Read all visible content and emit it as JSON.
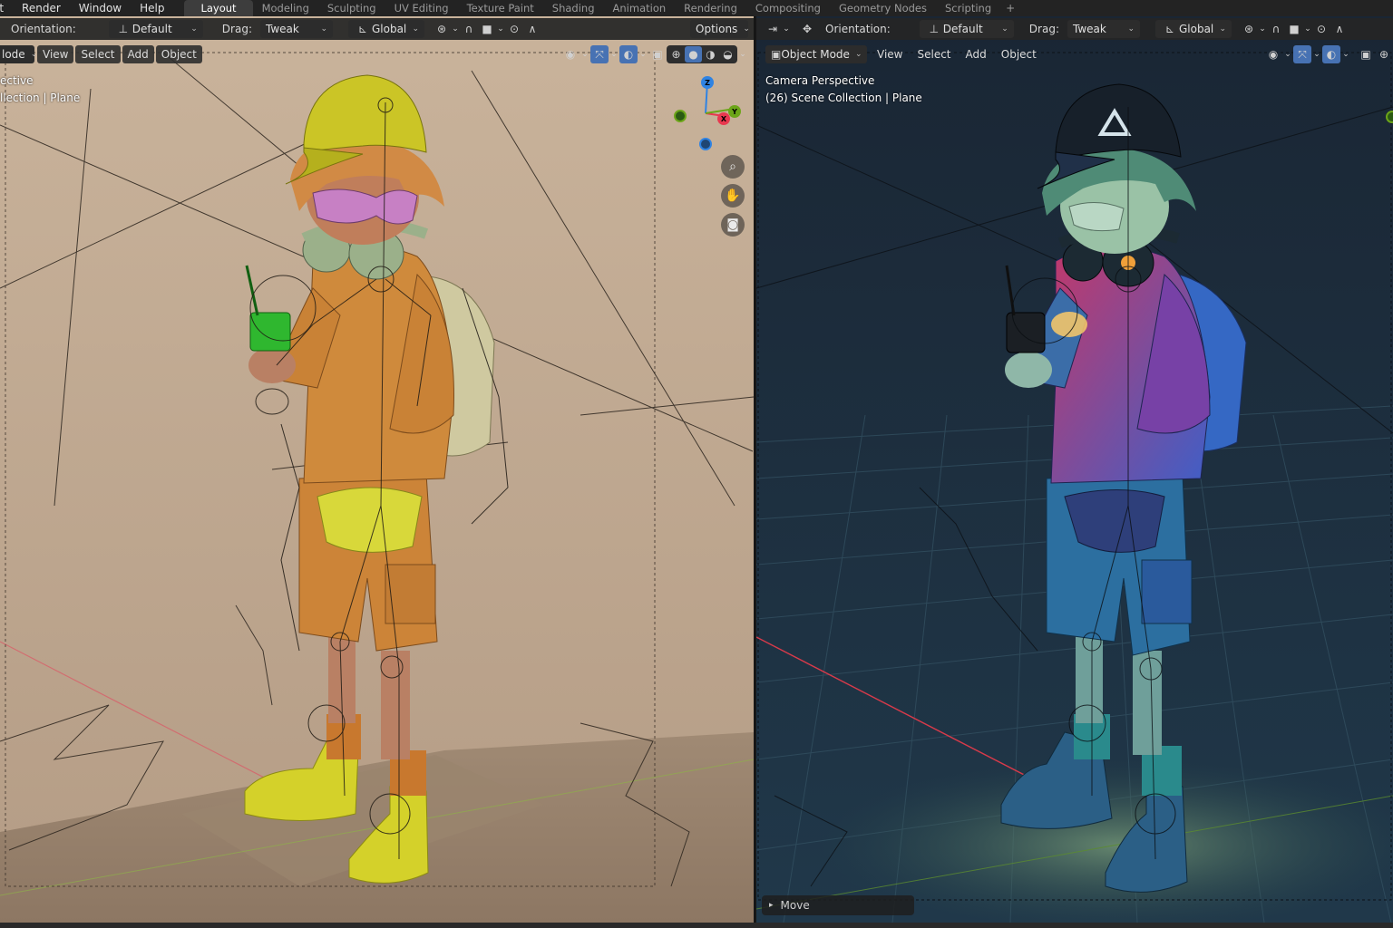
{
  "menu": [
    "it",
    "Render",
    "Window",
    "Help"
  ],
  "workspace_tabs": [
    {
      "label": "Layout",
      "active": true
    },
    {
      "label": "Modeling"
    },
    {
      "label": "Sculpting"
    },
    {
      "label": "UV Editing"
    },
    {
      "label": "Texture Paint"
    },
    {
      "label": "Shading"
    },
    {
      "label": "Animation"
    },
    {
      "label": "Rendering"
    },
    {
      "label": "Compositing"
    },
    {
      "label": "Geometry Nodes"
    },
    {
      "label": "Scripting"
    }
  ],
  "tab_add": "+",
  "left": {
    "orientation_label": "Orientation:",
    "orientation_value": "Default",
    "drag_label": "Drag:",
    "drag_value": "Tweak",
    "transform_space": "Global",
    "options_label": "Options",
    "mode": "lode",
    "menus": [
      "View",
      "Select",
      "Add",
      "Object"
    ],
    "overlay_line1": "ective",
    "overlay_line2": "llection | Plane",
    "gizmo_axes": [
      "Z",
      "Y",
      "X"
    ]
  },
  "right": {
    "orientation_label": "Orientation:",
    "orientation_value": "Default",
    "drag_label": "Drag:",
    "drag_value": "Tweak",
    "transform_space": "Global",
    "mode": "Object Mode",
    "menus": [
      "View",
      "Select",
      "Add",
      "Object"
    ],
    "overlay_line1": "Camera Perspective",
    "overlay_line2": "(26) Scene Collection | Plane",
    "last_operator": "Move"
  },
  "icons": {
    "cursor": "transform-pivot-icon",
    "snap": "magnet-icon",
    "proportional": "proportional-editing-icon",
    "zoom": "zoom-icon",
    "pan": "hand-icon",
    "camera": "camera-icon"
  },
  "colors": {
    "accent": "#4772b3",
    "x_axis": "#e8384f",
    "y_axis": "#6ca519",
    "z_axis": "#2f83e3",
    "left_bg": "#c2ab93",
    "right_bg": "#1b2b3a"
  }
}
